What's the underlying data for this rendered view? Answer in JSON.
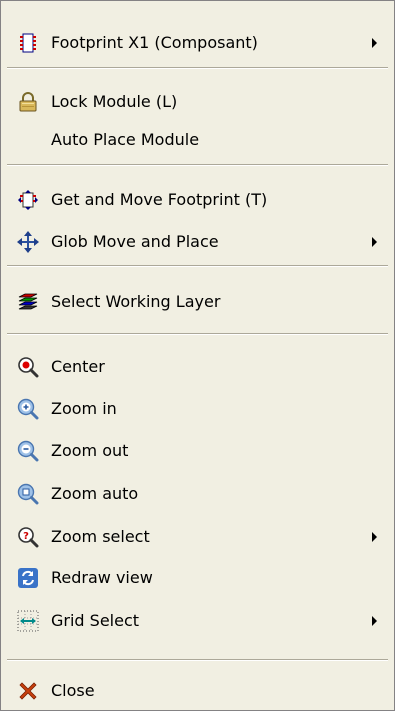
{
  "menu": {
    "footprint": {
      "label": "Footprint X1 (Composant)",
      "icon": "footprint-chip-icon",
      "has_submenu": true
    },
    "lock_module": {
      "label": "Lock Module (L)",
      "icon": "lock-icon"
    },
    "auto_place_module": {
      "label": "Auto Place Module"
    },
    "get_move_footprint": {
      "label": "Get and Move Footprint (T)",
      "icon": "move-footprint-icon"
    },
    "glob_move_place": {
      "label": "Glob Move and Place",
      "icon": "move-arrows-icon",
      "has_submenu": true
    },
    "select_working_layer": {
      "label": "Select Working Layer",
      "icon": "layers-icon"
    },
    "center": {
      "label": "Center",
      "icon": "center-magnifier-icon"
    },
    "zoom_in": {
      "label": "Zoom in",
      "icon": "zoom-in-icon"
    },
    "zoom_out": {
      "label": "Zoom out",
      "icon": "zoom-out-icon"
    },
    "zoom_auto": {
      "label": "Zoom auto",
      "icon": "zoom-auto-icon"
    },
    "zoom_select": {
      "label": "Zoom select",
      "icon": "zoom-select-icon",
      "has_submenu": true
    },
    "redraw_view": {
      "label": "Redraw view",
      "icon": "redraw-icon"
    },
    "grid_select": {
      "label": "Grid Select",
      "icon": "grid-icon",
      "has_submenu": true
    },
    "close": {
      "label": "Close",
      "icon": "close-x-icon"
    }
  }
}
